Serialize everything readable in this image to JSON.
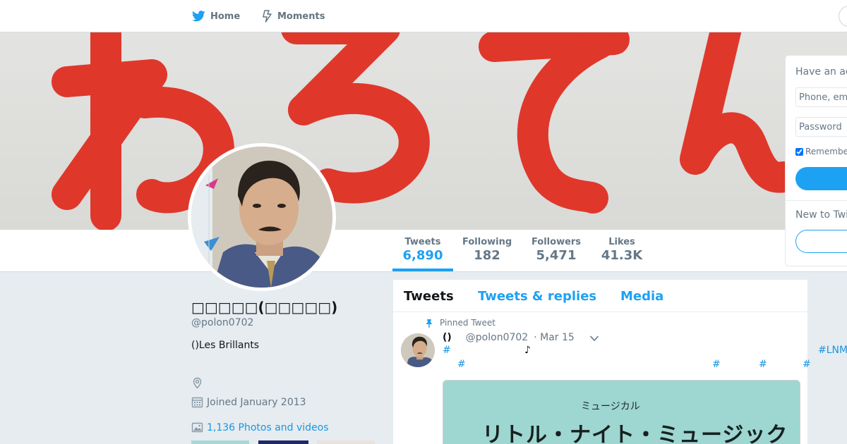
{
  "nav": {
    "home_label": "Home",
    "moments_label": "Moments"
  },
  "banner": {
    "lettering": "わろてん",
    "lettering_color": "#e0372b"
  },
  "stats": [
    {
      "label": "Tweets",
      "value": "6,890",
      "active": true
    },
    {
      "label": "Following",
      "value": "182",
      "active": false
    },
    {
      "label": "Followers",
      "value": "5,471",
      "active": false
    },
    {
      "label": "Likes",
      "value": "41.3K",
      "active": false
    }
  ],
  "profile": {
    "name": "□□□□□(□□□□□)",
    "handle": "@polon0702",
    "bio": "()Les Brillants",
    "joined": "Joined January 2013",
    "photos_videos": "1,136 Photos and videos"
  },
  "timeline": {
    "tabs": [
      "Tweets",
      "Tweets & replies",
      "Media"
    ],
    "active_tab": "Tweets",
    "pinned_label": "Pinned Tweet",
    "tweet": {
      "name": "()",
      "handle": "@polon0702",
      "date": "· Mar 15",
      "line1_hash": "#",
      "line1_note": "♪",
      "line1_tag_right": "#LNM",
      "line2_hashes": [
        "#",
        "#",
        "#",
        "#"
      ],
      "image_text_small": "ミュージカル",
      "image_text_large": "リトル・ナイト・ミュージック"
    }
  },
  "login": {
    "title": "Have an account?",
    "phone_placeholder": "Phone, email or username",
    "password_placeholder": "Password",
    "remember_label": "Remember me",
    "new_label": "New to Twitter?"
  },
  "colors": {
    "accent": "#1da1f2",
    "link": "#1b95e0",
    "background": "#e6ecf0"
  }
}
